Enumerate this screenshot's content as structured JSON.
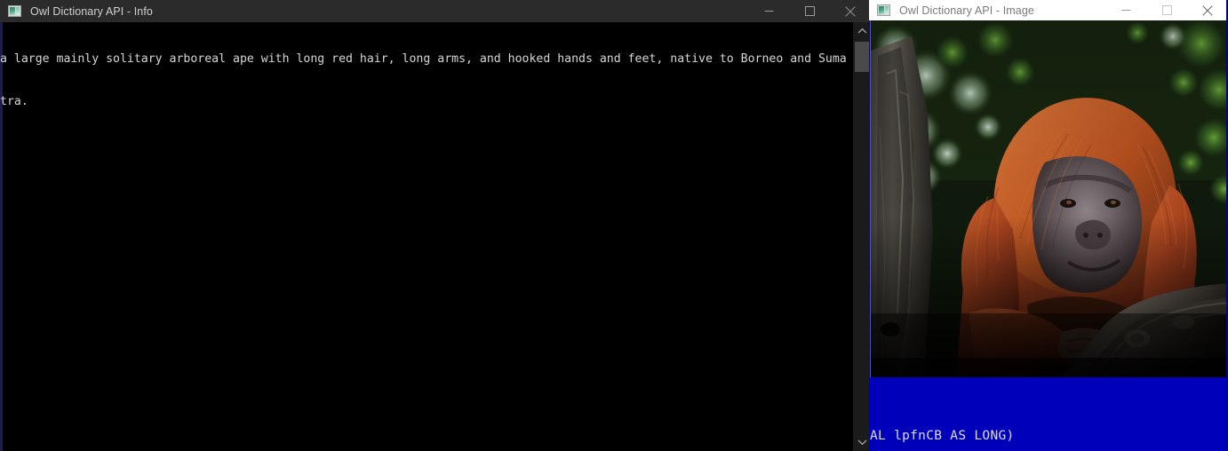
{
  "windows": {
    "info": {
      "title": "Owl Dictionary API - Info",
      "icon": "app-window-icon",
      "controls": {
        "minimize": "minimize-icon",
        "maximize": "maximize-icon",
        "close": "close-icon"
      },
      "content_lines": [
        "a large mainly solitary arboreal ape with long red hair, long arms, and hooked hands and feet, native to Borneo and Suma",
        "tra."
      ],
      "scrollbar": {
        "up_arrow": "chevron-up-icon",
        "down_arrow": "chevron-down-icon"
      }
    },
    "image": {
      "title": "Owl Dictionary API - Image",
      "icon": "app-window-icon",
      "controls": {
        "minimize": "minimize-icon",
        "maximize": "maximize-icon",
        "close": "close-icon"
      },
      "photo_alt": "orangutan-photo",
      "code_line": "AL lpfnCB AS LONG)"
    }
  },
  "colors": {
    "titlebar_dark": "#2b2b2b",
    "titlebar_light": "#ffffff",
    "console_bg": "#000000",
    "console_text": "#d6d6d6",
    "blue_panel": "#0000bb",
    "blue_text": "#dcdcf5"
  }
}
